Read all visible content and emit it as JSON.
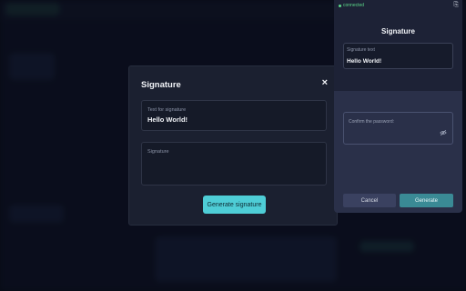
{
  "modal": {
    "title": "Signature",
    "close_icon": "×",
    "text_field": {
      "label": "Text for signature",
      "value": "Hello World!"
    },
    "signature_field": {
      "label": "Signature",
      "value": ""
    },
    "generate_label": "Generate signature"
  },
  "popup": {
    "status": "connected",
    "title": "Signature",
    "signature_text": {
      "label": "Signature text",
      "value": "Hello World!"
    },
    "password": {
      "placeholder": "Confirm the password:"
    },
    "cancel_label": "Cancel",
    "generate_label": "Generate"
  },
  "colors": {
    "accent": "#4ecdd6",
    "connected": "#5cd98a",
    "modal_bg": "#1b2030",
    "popup_bg": "#2a3049"
  }
}
